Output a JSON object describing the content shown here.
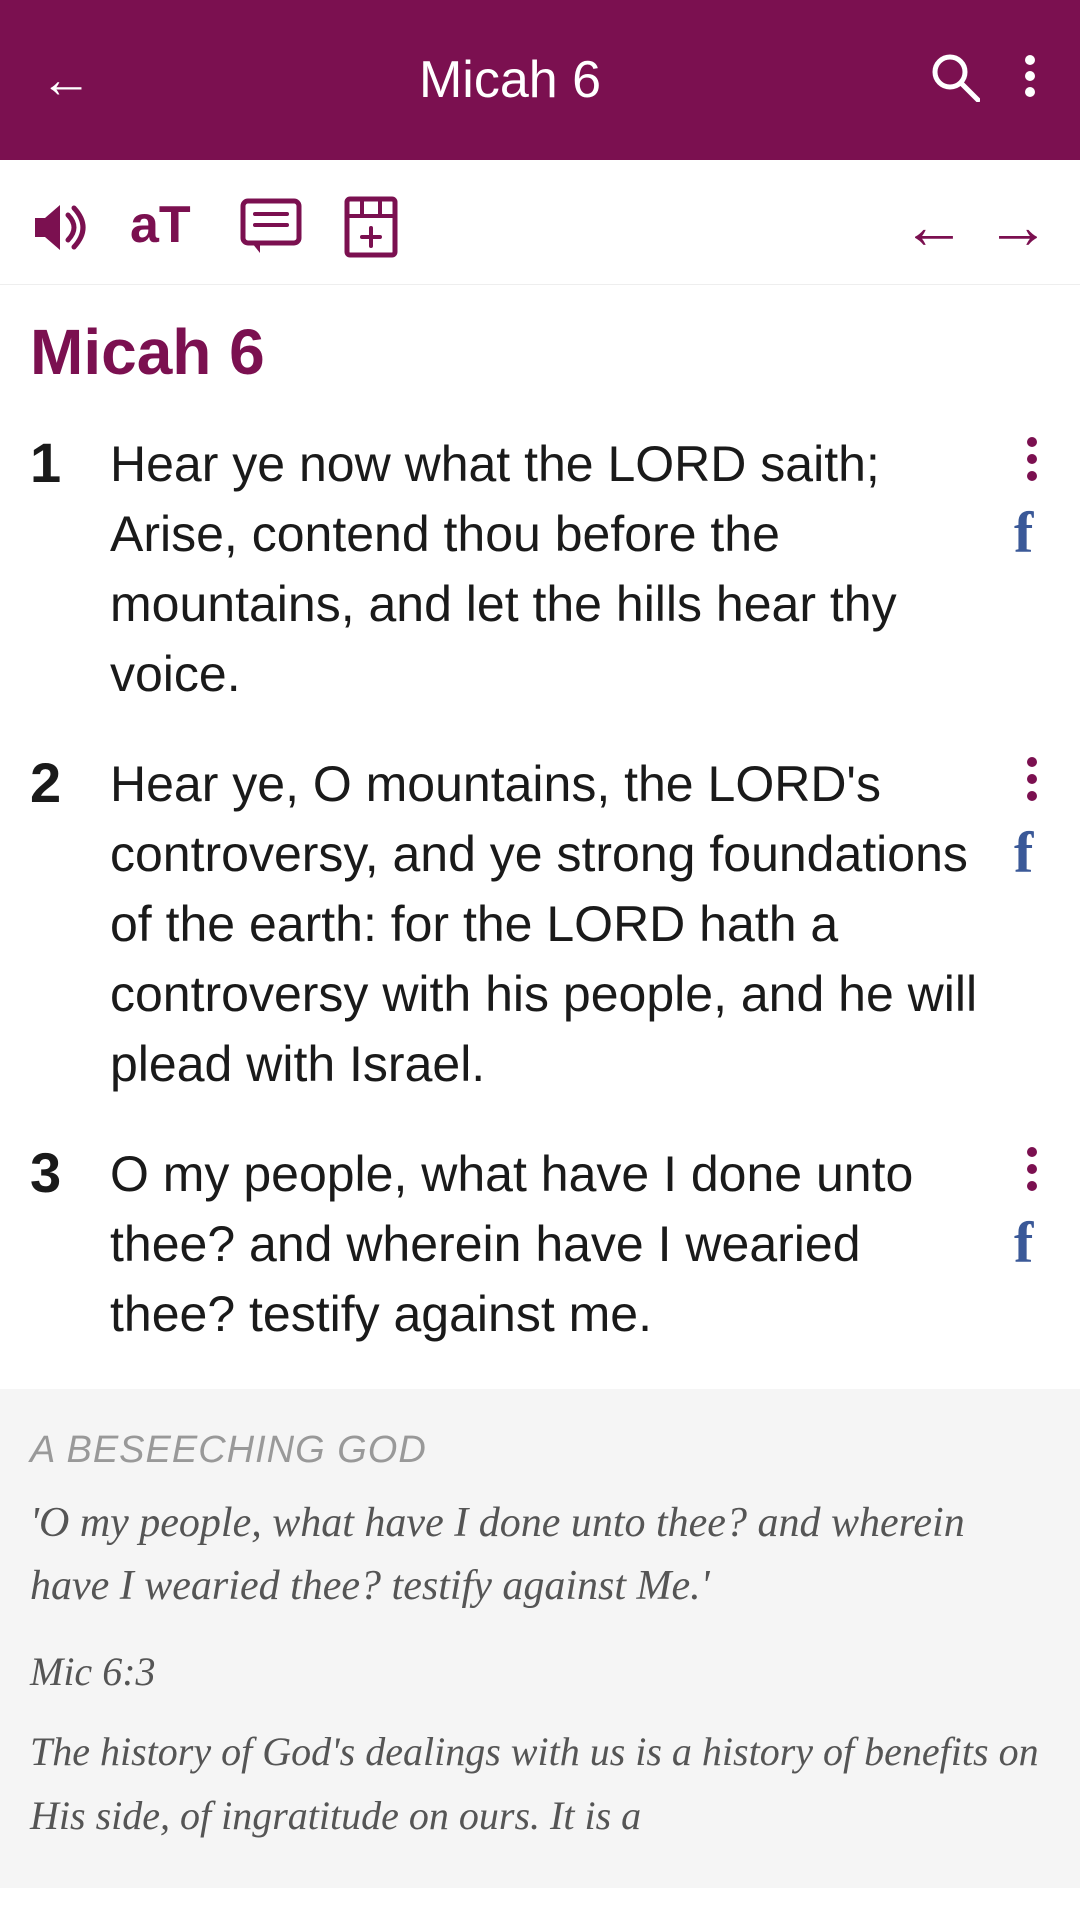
{
  "appBar": {
    "title": "Micah 6",
    "backIcon": "←",
    "searchIcon": "🔍",
    "moreIcon": "⋮"
  },
  "toolbar": {
    "icons": [
      "volume",
      "text-size",
      "comment",
      "bookmark"
    ],
    "prevIcon": "←",
    "nextIcon": "→"
  },
  "chapterTitle": "Micah 6",
  "verses": [
    {
      "number": "1",
      "text": "Hear ye now what the LORD saith; Arise, contend thou before the mountains, and let the hills hear thy voice."
    },
    {
      "number": "2",
      "text": "Hear ye, O mountains, the LORD's controversy, and ye strong foundations of the earth: for the LORD hath a controversy with his people, and he will plead with Israel."
    },
    {
      "number": "3",
      "text": "O my people, what have I done unto thee? and wherein have I wearied thee? testify against me."
    }
  ],
  "commentary": {
    "heading": "A BESEECHING GOD",
    "quote": "'O my people, what have I done unto thee? and wherein have I wearied thee? testify against Me.'",
    "reference": "Mic 6:3",
    "text": "The history of God's dealings with us is a history of benefits on His side, of ingratitude on ours. It is a"
  },
  "colors": {
    "primary": "#7b1050",
    "facebook": "#3b5998",
    "text": "#1a1a1a",
    "commentary": "#555555"
  }
}
